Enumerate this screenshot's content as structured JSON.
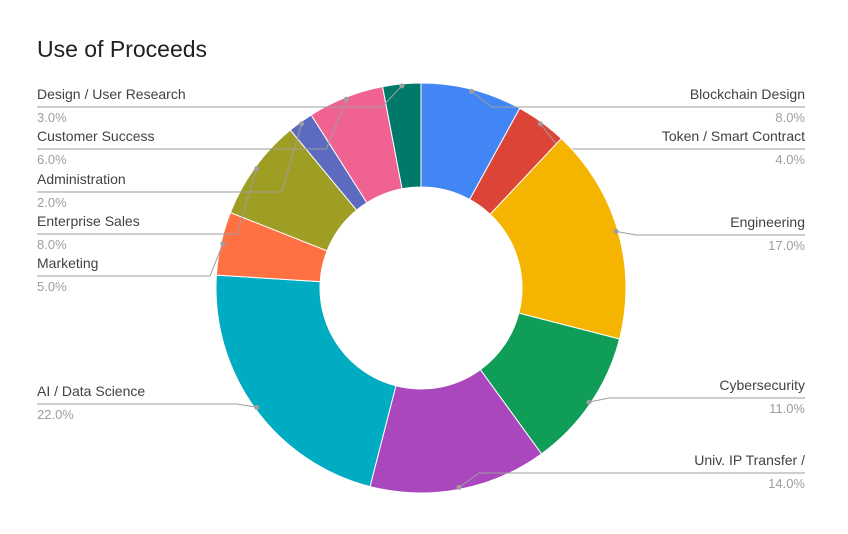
{
  "chart_data": {
    "type": "pie",
    "title": "Use of Proceeds",
    "categories": [
      "Blockchain Design",
      "Token / Smart Contract",
      "Engineering",
      "Cybersecurity",
      "Univ. IP Transfer /",
      "AI / Data Science",
      "Marketing",
      "Enterprise Sales",
      "Administration",
      "Customer Success",
      "Design / User Research"
    ],
    "values": [
      8.0,
      4.0,
      17.0,
      11.0,
      14.0,
      22.0,
      5.0,
      8.0,
      2.0,
      6.0,
      3.0
    ],
    "value_labels": [
      "8.0%",
      "4.0%",
      "17.0%",
      "11.0%",
      "14.0%",
      "22.0%",
      "5.0%",
      "8.0%",
      "2.0%",
      "6.0%",
      "3.0%"
    ],
    "colors": [
      "#4285f4",
      "#db4437",
      "#f4b400",
      "#0f9d58",
      "#ab47bc",
      "#00acc1",
      "#ff7043",
      "#9e9d24",
      "#5c6bc0",
      "#f06292",
      "#00796b"
    ],
    "donut": true,
    "legend": "labels beside slices with leader lines"
  }
}
